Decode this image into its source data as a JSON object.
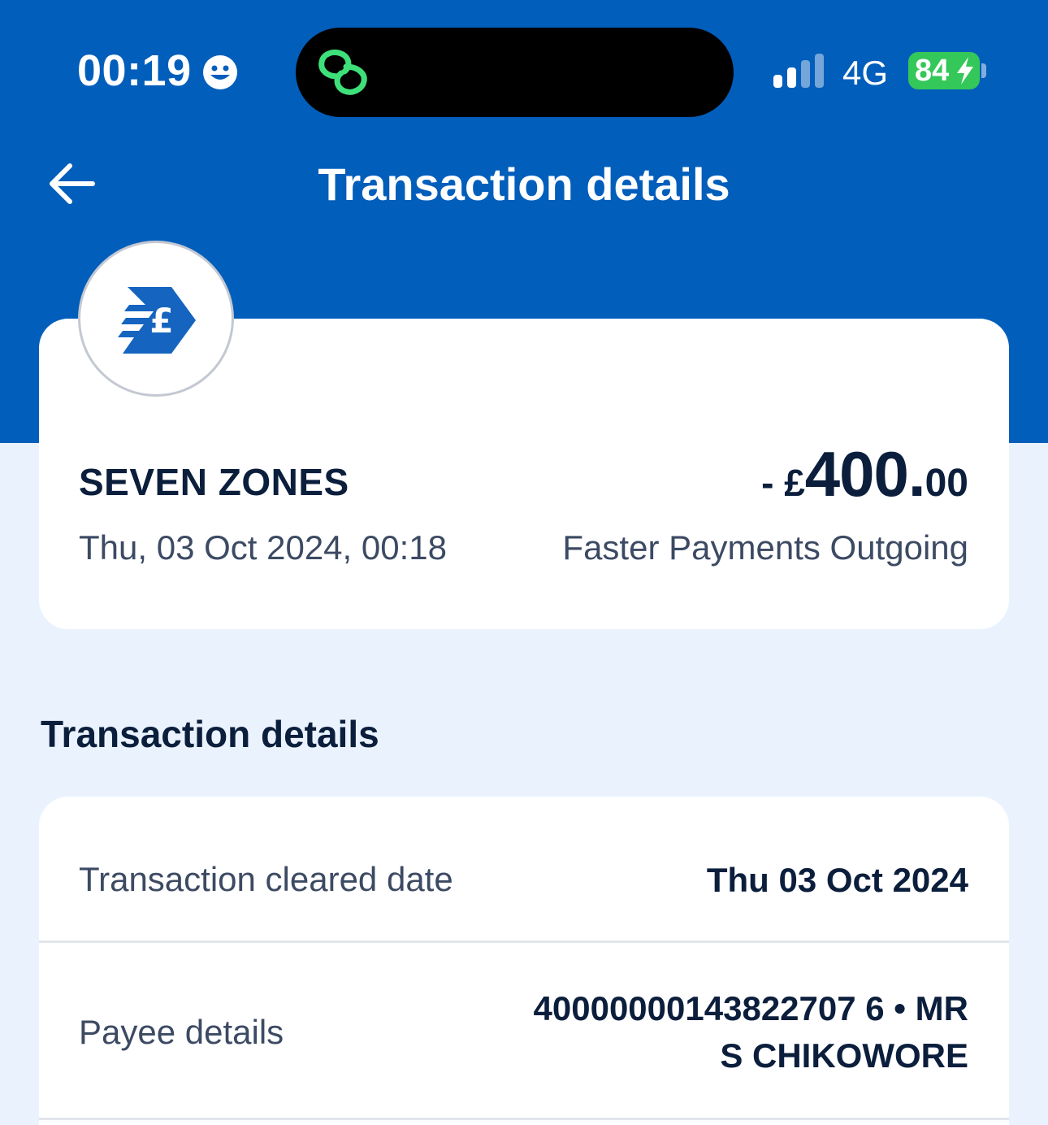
{
  "status_bar": {
    "time": "00:19",
    "network": "4G",
    "battery": "84",
    "icons": [
      "smiley-icon",
      "link-icon",
      "signal-icon",
      "battery-icon",
      "bolt-icon"
    ]
  },
  "header": {
    "title": "Transaction details",
    "back_icon": "back-arrow-icon"
  },
  "summary": {
    "merchant": "SEVEN ZONES",
    "datetime": "Thu, 03 Oct 2024, 00:18",
    "amount_sign": "- ",
    "amount_currency": "£",
    "amount_major": "400.",
    "amount_minor": "00",
    "payment_type": "Faster Payments Outgoing",
    "logo_icon": "faster-payment-pound-icon"
  },
  "section": {
    "title": "Transaction details"
  },
  "details": {
    "rows": [
      {
        "label": "Transaction cleared date",
        "value": "Thu 03 Oct 2024"
      },
      {
        "label": "Payee details",
        "value_line1": "40000000143822707 6 • MR",
        "value_line2": "S CHIKOWORE"
      }
    ]
  },
  "colors": {
    "brand_blue": "#025ebb",
    "background": "#eaf3fd",
    "text_dark": "#0b1e3c",
    "text_muted": "#3c4a63",
    "battery_green": "#34c759",
    "link_green": "#3ee07a"
  }
}
